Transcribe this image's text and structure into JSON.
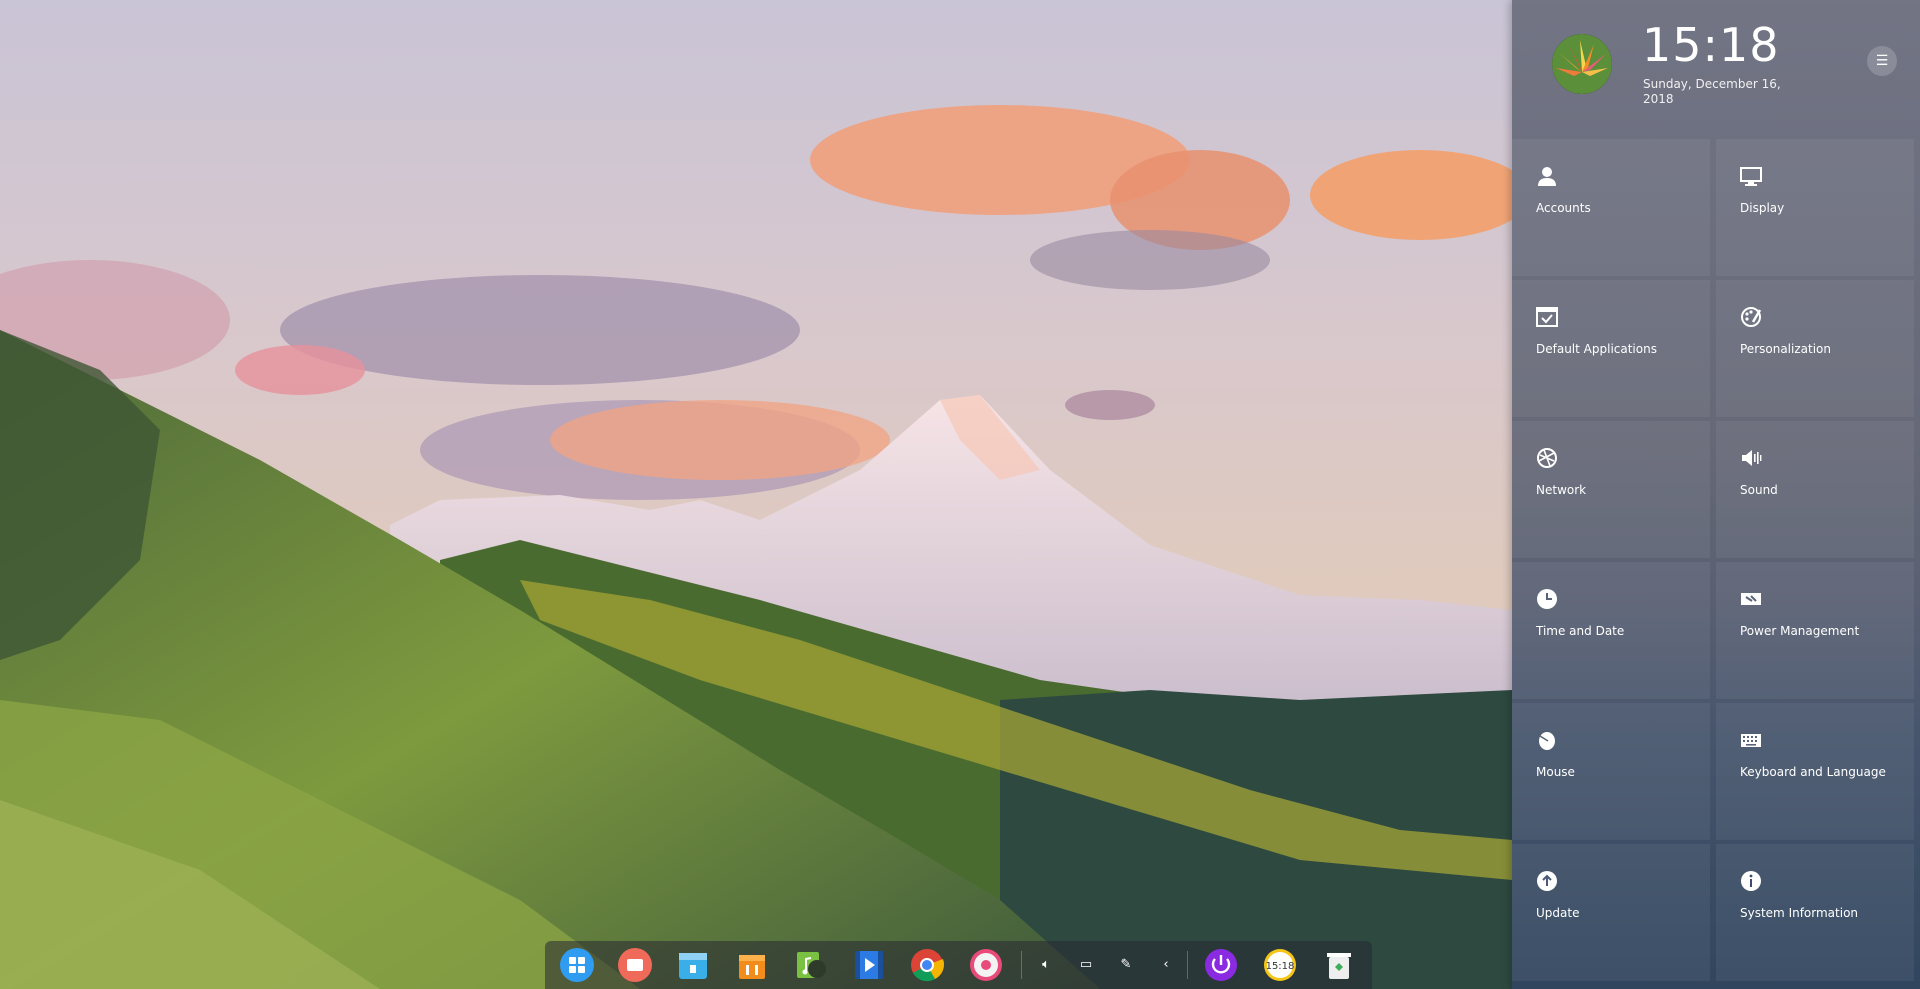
{
  "control_center": {
    "time": "15:18",
    "date": "Sunday, December 16, 2018",
    "menu_icon": "menu-icon",
    "tiles": [
      {
        "label": "Accounts",
        "icon": "user-icon"
      },
      {
        "label": "Display",
        "icon": "monitor-icon"
      },
      {
        "label": "Default Applications",
        "icon": "default-apps-icon"
      },
      {
        "label": "Personalization",
        "icon": "palette-icon"
      },
      {
        "label": "Network",
        "icon": "network-icon"
      },
      {
        "label": "Sound",
        "icon": "speaker-icon"
      },
      {
        "label": "Time and Date",
        "icon": "clock-icon"
      },
      {
        "label": "Power Management",
        "icon": "battery-icon"
      },
      {
        "label": "Mouse",
        "icon": "mouse-icon"
      },
      {
        "label": "Keyboard and Language",
        "icon": "keyboard-icon"
      },
      {
        "label": "Update",
        "icon": "update-icon"
      },
      {
        "label": "System Information",
        "icon": "info-icon"
      }
    ]
  },
  "dock": {
    "apps": [
      {
        "name": "launcher-icon",
        "color": "#2f9cf2"
      },
      {
        "name": "screen-recorder-icon",
        "color": "#f06a5a"
      },
      {
        "name": "file-manager-icon",
        "color": "#3aaee8"
      },
      {
        "name": "app-store-icon",
        "color": "#f28c1c"
      },
      {
        "name": "music-icon",
        "color": "#7ac142"
      },
      {
        "name": "movie-icon",
        "color": "#2c7be5"
      },
      {
        "name": "chrome-icon",
        "color": "#4285f4"
      },
      {
        "name": "settings-icon",
        "color": "#e84a7a"
      }
    ],
    "tray": [
      "volume-icon",
      "battery-status-icon",
      "pen-icon",
      "chevron-left-icon"
    ],
    "right": [
      {
        "name": "shutdown-icon",
        "color": "#8a2be2"
      },
      {
        "name": "clock-app-icon",
        "color": "#f5c518"
      },
      {
        "name": "trash-icon",
        "color": "#eeeeee"
      }
    ],
    "clock_app_text": "15:18"
  }
}
